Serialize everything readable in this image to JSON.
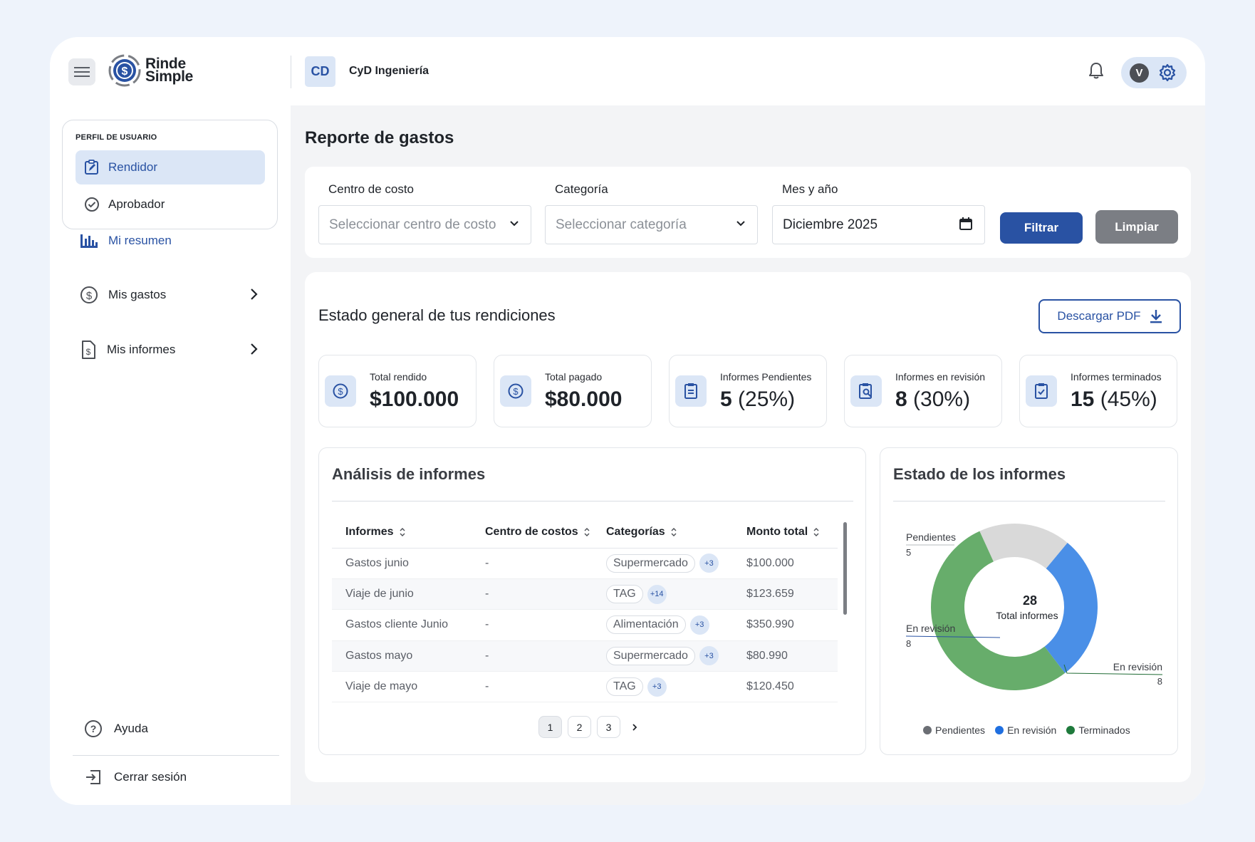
{
  "app": {
    "logo_line1": "Rinde",
    "logo_line2": "Simple",
    "company_badge": "CD",
    "company_name": "CyD Ingeniería",
    "user_initial": "V"
  },
  "sidebar": {
    "profile_title": "PERFIL DE USUARIO",
    "roles": [
      "Rendidor",
      "Aprobador"
    ],
    "nav": [
      "Mi resumen",
      "Mis gastos",
      "Mis informes"
    ],
    "help": "Ayuda",
    "logout": "Cerrar sesión"
  },
  "page": {
    "title": "Reporte de gastos"
  },
  "filters": {
    "cost_center_label": "Centro de costo",
    "cost_center_placeholder": "Seleccionar centro de costo",
    "category_label": "Categoría",
    "category_placeholder": "Seleccionar categoría",
    "month_label": "Mes y año",
    "month_value": "Diciembre 2025",
    "filter_button": "Filtrar",
    "clear_button": "Limpiar"
  },
  "overview": {
    "title": "Estado general de tus rendiciones",
    "pdf_button": "Descargar PDF",
    "stats": [
      {
        "label": "Total rendido",
        "value": "$100.000",
        "pct": ""
      },
      {
        "label": "Total pagado",
        "value": "$80.000",
        "pct": ""
      },
      {
        "label": "Informes Pendientes",
        "value": "5",
        "pct": "(25%)"
      },
      {
        "label": "Informes en revisión",
        "value": "8",
        "pct": "(30%)"
      },
      {
        "label": "Informes terminados",
        "value": "15",
        "pct": "(45%)"
      }
    ]
  },
  "analysis": {
    "title": "Análisis de informes",
    "columns": [
      "Informes",
      "Centro de costos",
      "Categorías",
      "Monto total"
    ],
    "rows": [
      {
        "informe": "Gastos junio",
        "centro": "-",
        "categoria": "Supermercado",
        "extra": "+3",
        "monto": "$100.000"
      },
      {
        "informe": "Viaje de junio",
        "centro": "-",
        "categoria": "TAG",
        "extra": "+14",
        "monto": "$123.659"
      },
      {
        "informe": "Gastos cliente Junio",
        "centro": "-",
        "categoria": "Alimentación",
        "extra": "+3",
        "monto": "$350.990"
      },
      {
        "informe": "Gastos mayo",
        "centro": "-",
        "categoria": "Supermercado",
        "extra": "+3",
        "monto": "$80.990"
      },
      {
        "informe": "Viaje de mayo",
        "centro": "-",
        "categoria": "TAG",
        "extra": "+3",
        "monto": "$120.450"
      }
    ],
    "pages": [
      "1",
      "2",
      "3"
    ],
    "current_page": "1"
  },
  "status_chart": {
    "title": "Estado de los informes",
    "center_value": "28",
    "center_label": "Total informes",
    "callouts": [
      {
        "label": "Pendientes",
        "value": "5"
      },
      {
        "label": "En revisión",
        "value": "8"
      },
      {
        "label": "En revisión",
        "value": "8"
      }
    ],
    "legend": [
      "Pendientes",
      "En revisión",
      "Terminados"
    ],
    "colors": {
      "pendientes": "#d9d9d9",
      "revision": "#4a8fe7",
      "terminados": "#67ad6b"
    }
  },
  "chart_data": {
    "type": "pie",
    "title": "Estado de los informes",
    "categories": [
      "Pendientes",
      "En revisión",
      "Terminados"
    ],
    "values": [
      5,
      8,
      15
    ],
    "total": 28
  },
  "colors": {
    "accent": "#2952a3",
    "accent_light": "#dbe6f6",
    "neutral_button": "#7b7e84"
  }
}
